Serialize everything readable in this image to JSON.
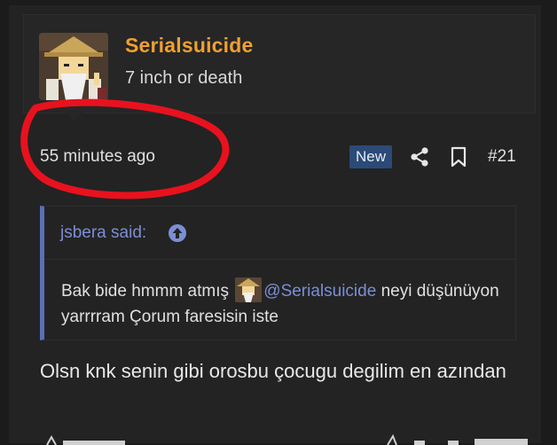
{
  "post": {
    "username": "Serialsuicide",
    "user_title": "7 inch or death",
    "time": "55 minutes ago",
    "badge": "New",
    "number": "#21"
  },
  "quote": {
    "author": "jsbera said:",
    "text_before": "Bak bide hmmm atmış",
    "mention": "@Serialsuicide",
    "text_after": "neyi düşünüyon yarrrram Çorum faresisin iste"
  },
  "reply": {
    "text": "Olsn knk senin gibi orosbu çocugu degilim en azından"
  },
  "icons": {
    "share": "share-icon",
    "bookmark": "bookmark-icon",
    "quote_link": "arrow-up-circle-icon"
  },
  "colors": {
    "username": "#f0a030",
    "badge_bg": "#2b4a78",
    "quote_accent": "#5b6fb5",
    "annotation": "#e8121e"
  }
}
